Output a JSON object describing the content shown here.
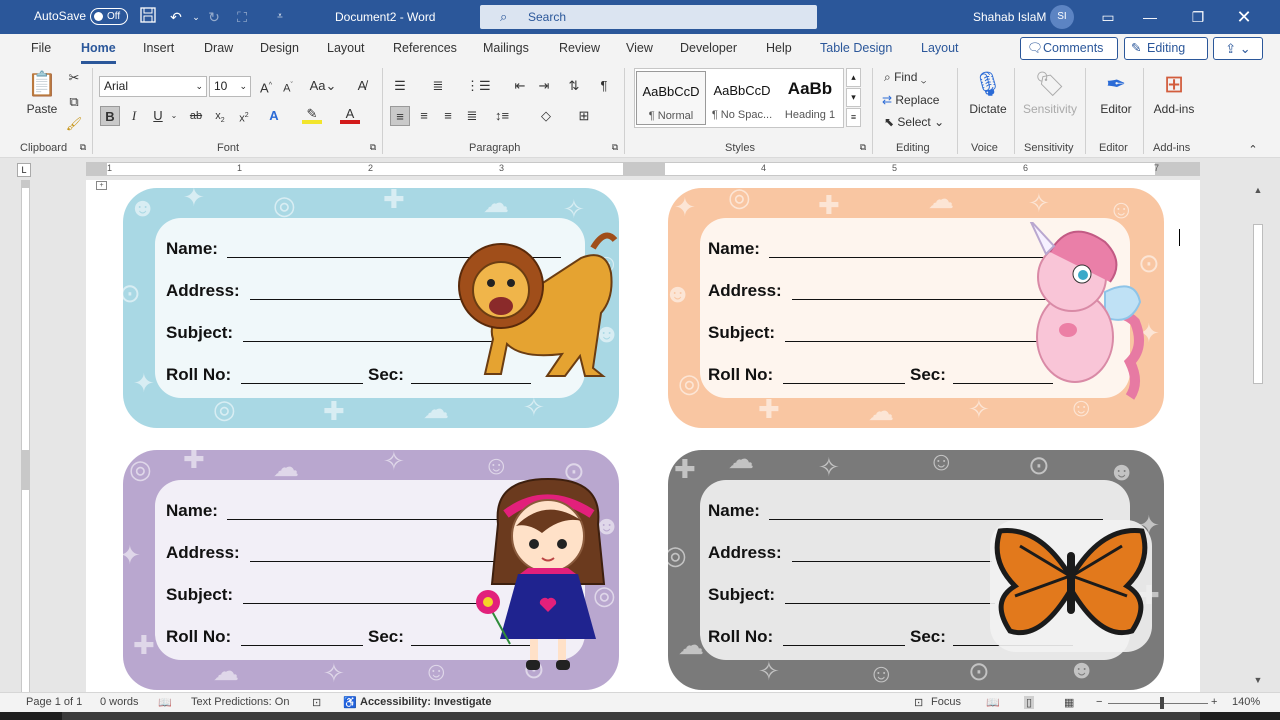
{
  "titlebar": {
    "autosave_label": "AutoSave",
    "autosave_state": "Off",
    "document_name": "Document2 - Word",
    "search_placeholder": "Search",
    "user_name": "Shahab IslaM",
    "user_initials": "SI"
  },
  "menu": {
    "items": [
      "File",
      "Home",
      "Insert",
      "Draw",
      "Design",
      "Layout",
      "References",
      "Mailings",
      "Review",
      "View",
      "Developer",
      "Help",
      "Table Design",
      "Layout"
    ],
    "active": "Home",
    "comments_label": "Comments",
    "editing_label": "Editing"
  },
  "ribbon": {
    "clipboard": {
      "label": "Clipboard",
      "paste": "Paste"
    },
    "font": {
      "label": "Font",
      "family": "Arial",
      "size": "10",
      "case_label": "Aa"
    },
    "paragraph": {
      "label": "Paragraph"
    },
    "styles": {
      "label": "Styles",
      "tiles": [
        {
          "sample": "AaBbCcD",
          "name": "¶ Normal"
        },
        {
          "sample": "AaBbCcD",
          "name": "¶ No Spac..."
        },
        {
          "sample": "AaBb",
          "name": "Heading 1"
        }
      ]
    },
    "editing": {
      "label": "Editing",
      "find": "Find",
      "replace": "Replace",
      "select": "Select"
    },
    "voice": {
      "label": "Voice",
      "dictate": "Dictate"
    },
    "sensitivity": {
      "label": "Sensitivity",
      "button": "Sensitivity"
    },
    "editor": {
      "label": "Editor",
      "button": "Editor"
    },
    "addins": {
      "label": "Add-ins",
      "button": "Add-ins"
    }
  },
  "ruler": {
    "numbers": [
      "1",
      "1",
      "2",
      "3",
      "4",
      "5",
      "6",
      "7"
    ]
  },
  "labels": {
    "fields": [
      "Name:",
      "Address:",
      "Subject:",
      "Roll No:",
      "Sec:"
    ],
    "cards": [
      {
        "color": "#a9d8e4",
        "art": "lion"
      },
      {
        "color": "#f9c6a2",
        "art": "unicorn"
      },
      {
        "color": "#b9a7cf",
        "art": "girl"
      },
      {
        "color": "#7a7a7a",
        "art": "butterfly"
      }
    ]
  },
  "statusbar": {
    "page": "Page 1 of 1",
    "words": "0 words",
    "predictions": "Text Predictions: On",
    "accessibility": "Accessibility: Investigate",
    "focus": "Focus",
    "zoom": "140%"
  },
  "colors": {
    "brand": "#2b579a",
    "ribbon_bg": "#f3f3f3"
  }
}
